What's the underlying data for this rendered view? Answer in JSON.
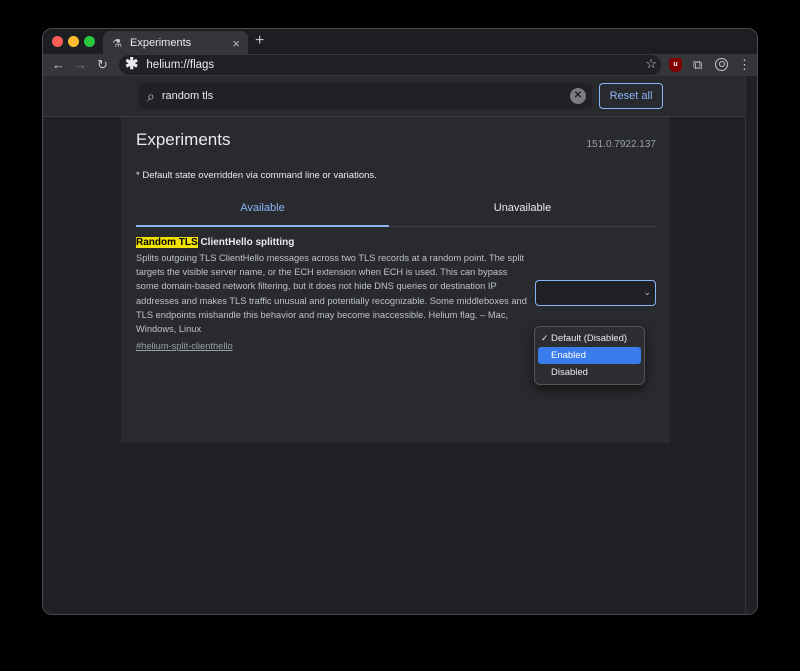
{
  "tab": {
    "title": "Experiments",
    "close": "×",
    "new_tab": "+"
  },
  "toolbar": {
    "back": "←",
    "forward": "→",
    "reload": "↻",
    "url_icon": "✱",
    "url": "helium://flags",
    "bookmark_icon": "☆",
    "ublock_label": "u",
    "extensions_icon": "⧉",
    "menu_icon": "⋮"
  },
  "search": {
    "icon": "⌕",
    "value": "random tls",
    "clear": "✕",
    "reset_label": "Reset all"
  },
  "page": {
    "title": "Experiments",
    "version": "151.0.7922.137",
    "note": "* Default state overridden via command line or variations.",
    "tabs": [
      "Available",
      "Unavailable"
    ]
  },
  "experiment": {
    "title_highlight": "Random TLS",
    "title_rest": " ClientHello splitting",
    "description": "Splits outgoing TLS ClientHello messages across two TLS records at a random point. The split targets the visible server name, or the ECH extension when ECH is used. This can bypass some domain-based network filtering, but it does not hide DNS queries or destination IP addresses and makes TLS traffic unusual and potentially recognizable. Some middleboxes and TLS endpoints mishandle this behavior and may become inaccessible. Helium flag. – Mac, Windows, Linux",
    "link": "#helium-split-clienthello",
    "select_chevron": "⌄"
  },
  "dropdown": {
    "check": "✓",
    "options": [
      "Default (Disabled)",
      "Enabled",
      "Disabled"
    ],
    "checked_index": 0,
    "highlighted_index": 1
  },
  "colors": {
    "accent": "#8ab4f8",
    "highlight": "#f1e200",
    "selection": "#3a7cec"
  }
}
